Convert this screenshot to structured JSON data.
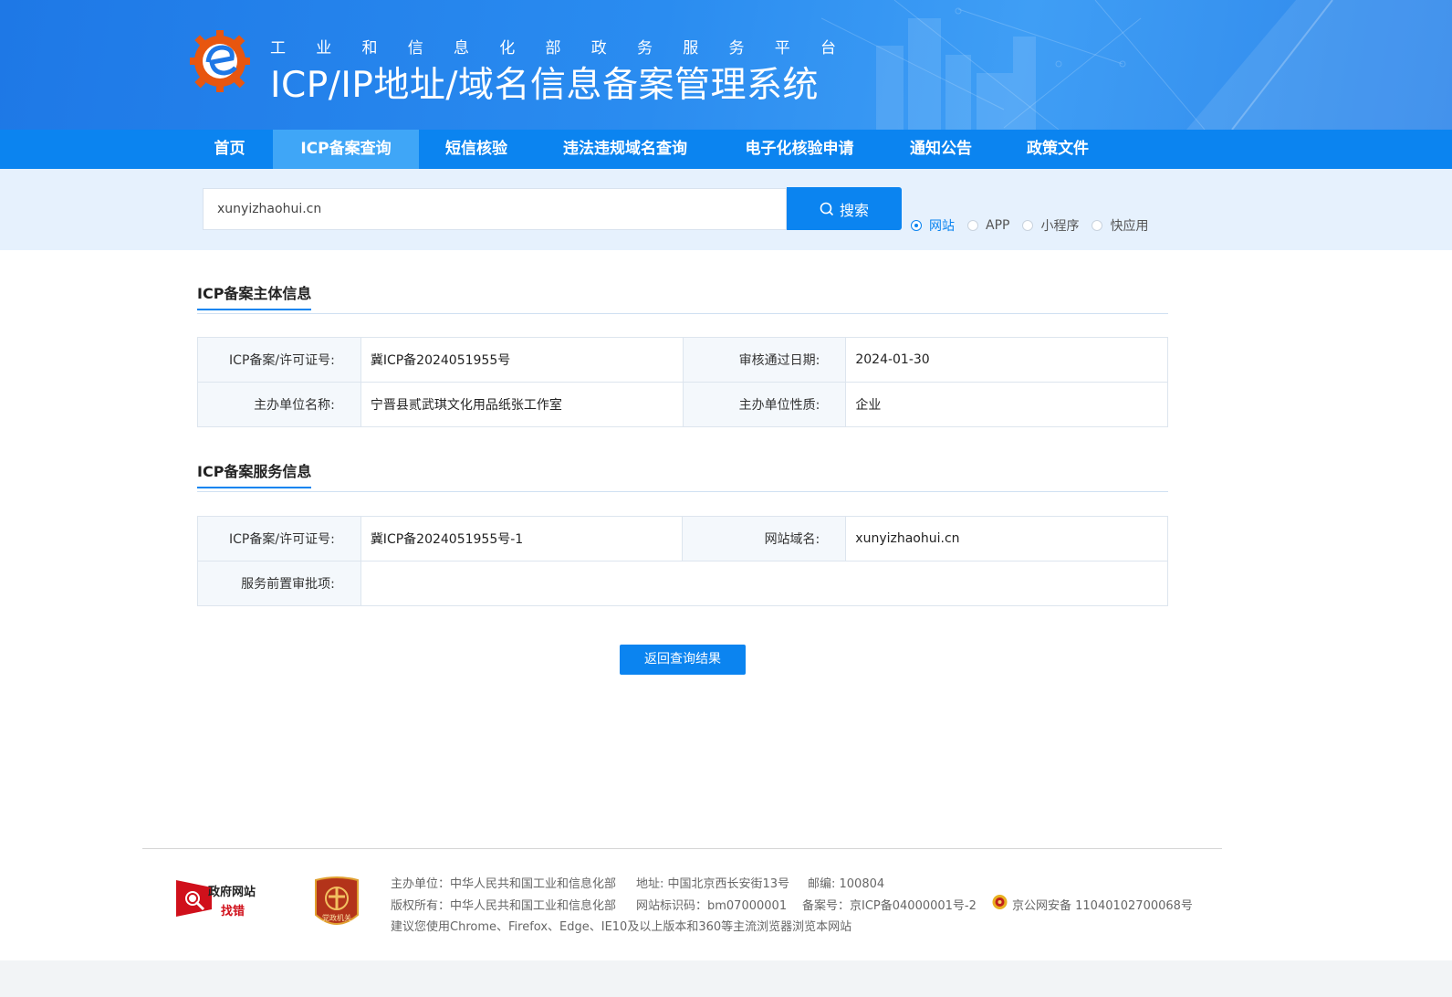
{
  "header": {
    "subtitle_chars": [
      "工",
      "业",
      "和",
      "信",
      "息",
      "化",
      "部",
      "政",
      "务",
      "服",
      "务",
      "平",
      "台"
    ],
    "title": "ICP/IP地址/域名信息备案管理系统"
  },
  "nav": {
    "items": [
      {
        "label": "首页"
      },
      {
        "label": "ICP备案查询",
        "active": true
      },
      {
        "label": "短信核验"
      },
      {
        "label": "违法违规域名查询"
      },
      {
        "label": "电子化核验申请"
      },
      {
        "label": "通知公告"
      },
      {
        "label": "政策文件"
      }
    ]
  },
  "search": {
    "value": "xunyizhaohui.cn",
    "button_label": "搜索",
    "options": [
      {
        "label": "网站",
        "checked": true
      },
      {
        "label": "APP",
        "checked": false
      },
      {
        "label": "小程序",
        "checked": false
      },
      {
        "label": "快应用",
        "checked": false
      }
    ]
  },
  "subject": {
    "title": "ICP备案主体信息",
    "license_label": "ICP备案/许可证号:",
    "license_value": "冀ICP备2024051955号",
    "date_label": "审核通过日期:",
    "date_value": "2024-01-30",
    "org_label": "主办单位名称:",
    "org_value": "宁晋县贰武琪文化用品纸张工作室",
    "nature_label": "主办单位性质:",
    "nature_value": "企业"
  },
  "service": {
    "title": "ICP备案服务信息",
    "license_label": "ICP备案/许可证号:",
    "license_value": "冀ICP备2024051955号-1",
    "domain_label": "网站域名:",
    "domain_value": "xunyizhaohui.cn",
    "approval_label": "服务前置审批项:",
    "approval_value": ""
  },
  "return_button": "返回查询结果",
  "footer": {
    "gov_logo_line1": "政府网站",
    "gov_logo_line2": "找错",
    "party_logo_text": "党政机关",
    "sponsor": "主办单位：中华人民共和国工业和信息化部",
    "address": "地址: 中国北京西长安街13号",
    "postcode": "邮编: 100804",
    "copyright": "版权所有：中华人民共和国工业和信息化部",
    "site_id": "网站标识码：bm07000001",
    "record_no": "备案号：京ICP备04000001号-2",
    "police_no": "京公网安备 11040102700068号",
    "browser_note": "建议您使用Chrome、Firefox、Edge、IE10及以上版本和360等主流浏览器浏览本网站"
  },
  "colors": {
    "brand_blue": "#0b84f0",
    "nav_active": "#3fa6f7",
    "search_band": "#e6f1fd",
    "label_bg": "#f4f8fc"
  },
  "icons": [
    "miit-logo-icon",
    "search-icon",
    "gov-website-error-icon",
    "party-gov-badge-icon",
    "police-badge-icon"
  ]
}
